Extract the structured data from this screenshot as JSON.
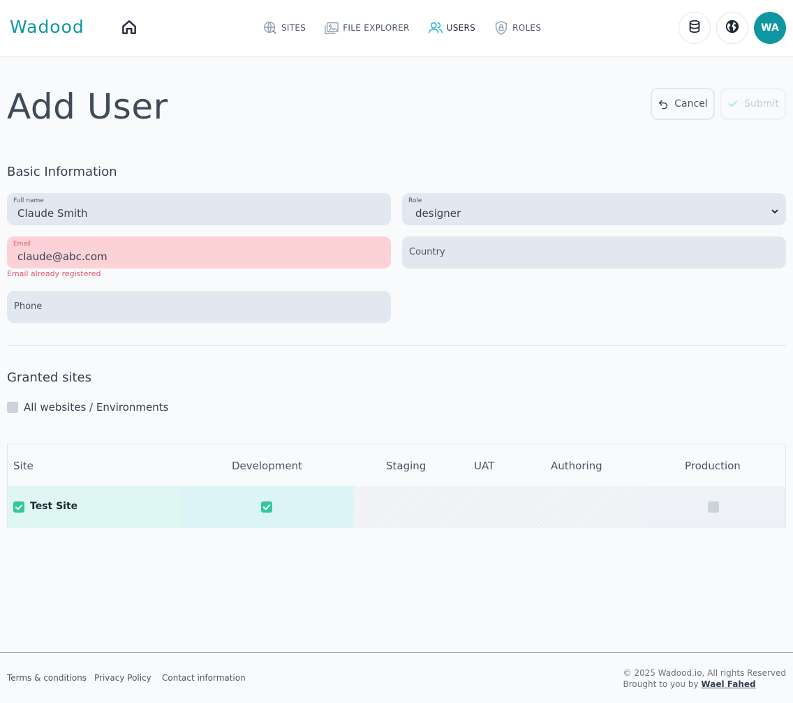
{
  "brand": {
    "logo_text": "Wadood",
    "accent": "#0e97a0"
  },
  "nav": {
    "items": [
      {
        "label": "SITES",
        "icon": "globe-icon",
        "active": false
      },
      {
        "label": "FILE EXPLORER",
        "icon": "folder-image-icon",
        "active": false
      },
      {
        "label": "USERS",
        "icon": "users-icon",
        "active": true
      },
      {
        "label": "ROLES",
        "icon": "shield-lock-icon",
        "active": false
      }
    ]
  },
  "header": {
    "avatar_initials": "WA"
  },
  "page": {
    "title": "Add User",
    "cancel_label": "Cancel",
    "submit_label": "Submit"
  },
  "basic_info": {
    "title": "Basic Information",
    "full_name": {
      "label": "Full name",
      "value": "Claude Smith"
    },
    "role": {
      "label": "Role",
      "value": "designer"
    },
    "email": {
      "label": "Email",
      "value": "claude@abc.com",
      "error": "Email already registered"
    },
    "country": {
      "placeholder": "Country"
    },
    "phone": {
      "placeholder": "Phone"
    }
  },
  "granted_sites": {
    "title": "Granted sites",
    "all_label": "All websites / Environments",
    "all_checked": false,
    "columns": [
      "Site",
      "Development",
      "Staging",
      "UAT",
      "Authoring",
      "Production"
    ],
    "rows": [
      {
        "site": "Test Site",
        "site_checked": true,
        "development": true,
        "staging": null,
        "uat": null,
        "authoring": null,
        "production": false
      }
    ]
  },
  "footer": {
    "links": [
      "Terms & conditions",
      "Privacy Policy",
      "Contact information"
    ],
    "copyright": "© 2025 Wadood.io, All rights Reserved",
    "brought_by": "Brought to you by",
    "author": "Wael Fahed"
  }
}
